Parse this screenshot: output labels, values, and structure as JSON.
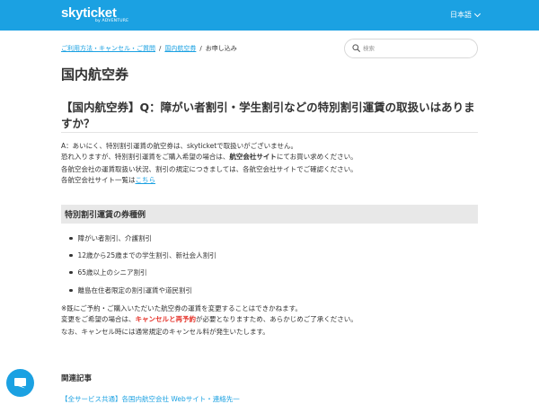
{
  "header": {
    "logo_text": "skyticket",
    "logo_sub": "by ADVENTURE",
    "language": "日本語",
    "brand_color": "#1ba1e2"
  },
  "breadcrumb": {
    "items": [
      "ご利用方法・キャンセル・ご質問",
      "国内航空券"
    ],
    "current": "お申し込み"
  },
  "search": {
    "placeholder": "検索"
  },
  "category_title": "国内航空券",
  "article": {
    "title": "【国内航空券】Q：障がい者割引・学生割引などの特別割引運賃の取扱いはありますか？",
    "p1_line1": "A：あいにく、特別割引運賃の航空券は、skyticketで取扱いがございません。",
    "p1_line2_pre": "恐れ入りますが、特別割引運賃をご購入希望の場合は、",
    "p1_line2_bold": "航空会社サイト",
    "p1_line2_post": "にてお買い求めください。",
    "p2_line1": "各航空会社の運賃取扱い状況、割引の規定につきましては、各航空会社サイトでご確認ください。",
    "p2_line2_pre": "各航空会社サイト一覧は",
    "p2_link": "こちら",
    "section_heading": "特別割引運賃の券種例",
    "list": [
      "障がい者割引、介護割引",
      "12歳から25歳までの学生割引、新社会人割引",
      "65歳以上のシニア割引",
      "離島在住者限定の割引運賃や道民割引"
    ],
    "note_line1": "※既にご予約・ご購入いただいた航空券の運賃を変更することはできかねます。",
    "note_line2_pre": "変更をご希望の場合は、",
    "note_line2_red": "キャンセルと再予約",
    "note_line2_post": "が必要となりますため、あらかじめご了承ください。",
    "note_line3": "なお、キャンセル時には通常規定のキャンセル料が発生いたします。"
  },
  "related": {
    "heading": "関連記事",
    "links": [
      "【全サービス共通】各国内航空会社 Webサイト・連絡先一"
    ]
  },
  "icons": {
    "search": "search-icon",
    "chat": "chat-icon",
    "language_dropdown": "chevron-down-icon"
  }
}
